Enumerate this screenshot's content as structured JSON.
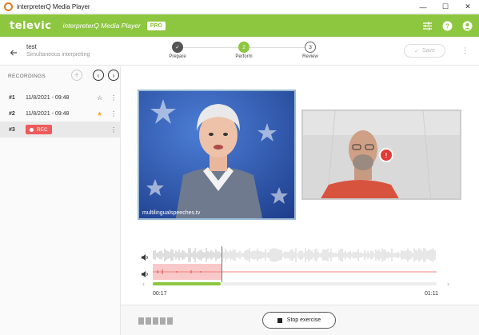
{
  "window": {
    "title": "interpreterQ Media Player",
    "minimize": "—",
    "maximize": "☐",
    "close": "✕"
  },
  "header": {
    "logo": "televic",
    "app_title": "interpreterQ Media Player",
    "badge": "PRO"
  },
  "exercise": {
    "title": "test",
    "subtitle": "Simultaneous interpreting",
    "save_label": "Save"
  },
  "steps": [
    {
      "label": "Prepare",
      "marker": "✓",
      "state": "done"
    },
    {
      "label": "Perform",
      "marker": "2",
      "state": "active"
    },
    {
      "label": "Review",
      "marker": "3",
      "state": "todo"
    }
  ],
  "sidebar": {
    "title": "RECORDINGS",
    "add": "+",
    "prev": "‹",
    "next": "›",
    "items": [
      {
        "num": "#1",
        "date": "11/8/2021 - 09:48",
        "star": "☆",
        "starred": false
      },
      {
        "num": "#2",
        "date": "11/8/2021 - 09:48",
        "star": "★",
        "starred": true
      },
      {
        "num": "#3",
        "badge": "REC",
        "selected": true
      }
    ]
  },
  "video": {
    "watermark": "multilingualspeeches.tv",
    "alert": "!"
  },
  "timeline": {
    "start": "00:17",
    "end": "01:11",
    "progress": 0.24
  },
  "controls": {
    "stop_label": "Stop exercise"
  },
  "colors": {
    "brand": "#8dc63f",
    "rec": "#ef5a5a",
    "star": "#f5a623"
  }
}
